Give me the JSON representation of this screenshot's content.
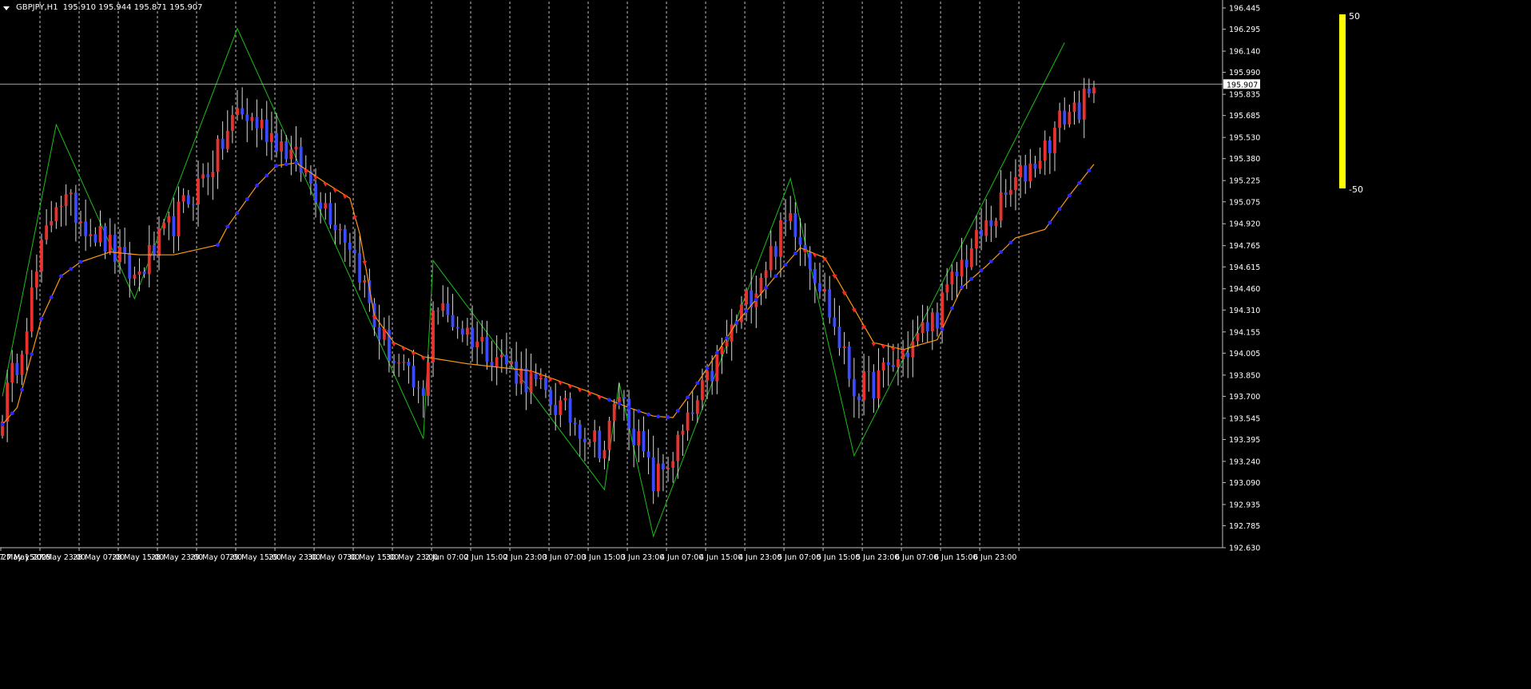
{
  "header": {
    "symbol": "GBPJPY,H1",
    "ohlc": "195.910 195.944 195.871 195.907"
  },
  "colors": {
    "background": "#000000",
    "bull_candle": "#e8322e",
    "bear_candle": "#3b4bff",
    "zigzag": "#18c018",
    "ma_line": "#ff9a10",
    "up_dots": "#2a2aff",
    "down_dots": "#ff2222",
    "histogram": "#ffff00",
    "grid": "#ffffff",
    "price_line": "#c8c8c8"
  },
  "histogram": {
    "top_label": "50",
    "bottom_label": "-50"
  },
  "chart_data": {
    "type": "candlestick",
    "symbol": "GBPJPY",
    "timeframe": "H1",
    "current_price": 195.907,
    "y_ticks": [
      "196.445",
      "196.295",
      "196.140",
      "195.990",
      "195.835",
      "195.685",
      "195.530",
      "195.380",
      "195.225",
      "195.075",
      "194.920",
      "194.765",
      "194.615",
      "194.460",
      "194.310",
      "194.155",
      "194.005",
      "193.850",
      "193.700",
      "193.545",
      "193.395",
      "193.240",
      "193.090",
      "192.935",
      "192.785",
      "192.630"
    ],
    "x_labels": [
      "27 May 2025",
      "27 May 15:00",
      "27 May 23:00",
      "28 May 07:00",
      "28 May 15:00",
      "28 May 23:00",
      "29 May 07:00",
      "29 May 15:00",
      "29 May 23:00",
      "30 May 07:00",
      "30 May 15:00",
      "30 May 23:00",
      "2 Jun 07:00",
      "2 Jun 15:00",
      "2 Jun 23:00",
      "3 Jun 07:00",
      "3 Jun 15:00",
      "3 Jun 23:00",
      "4 Jun 07:00",
      "4 Jun 15:00",
      "4 Jun 23:00",
      "5 Jun 07:00",
      "5 Jun 15:00",
      "5 Jun 23:00",
      "6 Jun 07:00",
      "6 Jun 15:00",
      "6 Jun 23:00"
    ],
    "zigzag": [
      {
        "t": 0,
        "p": 193.7
      },
      {
        "t": 11,
        "p": 195.62
      },
      {
        "t": 27,
        "p": 194.39
      },
      {
        "t": 48,
        "p": 196.3
      },
      {
        "t": 86,
        "p": 193.4
      },
      {
        "t": 88,
        "p": 194.66
      },
      {
        "t": 123,
        "p": 193.04
      },
      {
        "t": 126,
        "p": 193.8
      },
      {
        "t": 133,
        "p": 192.71
      },
      {
        "t": 161,
        "p": 195.24
      },
      {
        "t": 174,
        "p": 193.28
      },
      {
        "t": 217,
        "p": 196.2
      }
    ],
    "ma_anchors": [
      {
        "t": 0,
        "p": 193.5
      },
      {
        "t": 3,
        "p": 193.62
      },
      {
        "t": 8,
        "p": 194.25
      },
      {
        "t": 12,
        "p": 194.55
      },
      {
        "t": 16,
        "p": 194.65
      },
      {
        "t": 22,
        "p": 194.72
      },
      {
        "t": 28,
        "p": 194.7
      },
      {
        "t": 35,
        "p": 194.7
      },
      {
        "t": 44,
        "p": 194.77
      },
      {
        "t": 46,
        "p": 194.9
      },
      {
        "t": 52,
        "p": 195.19
      },
      {
        "t": 56,
        "p": 195.33
      },
      {
        "t": 60,
        "p": 195.35
      },
      {
        "t": 66,
        "p": 195.21
      },
      {
        "t": 71,
        "p": 195.1
      },
      {
        "t": 73,
        "p": 194.85
      },
      {
        "t": 76,
        "p": 194.27
      },
      {
        "t": 80,
        "p": 194.08
      },
      {
        "t": 86,
        "p": 193.98
      },
      {
        "t": 95,
        "p": 193.93
      },
      {
        "t": 108,
        "p": 193.88
      },
      {
        "t": 120,
        "p": 193.73
      },
      {
        "t": 128,
        "p": 193.62
      },
      {
        "t": 133,
        "p": 193.56
      },
      {
        "t": 137,
        "p": 193.55
      },
      {
        "t": 141,
        "p": 193.74
      },
      {
        "t": 150,
        "p": 194.22
      },
      {
        "t": 158,
        "p": 194.55
      },
      {
        "t": 163,
        "p": 194.75
      },
      {
        "t": 168,
        "p": 194.68
      },
      {
        "t": 173,
        "p": 194.38
      },
      {
        "t": 178,
        "p": 194.08
      },
      {
        "t": 184,
        "p": 194.03
      },
      {
        "t": 191,
        "p": 194.1
      },
      {
        "t": 196,
        "p": 194.47
      },
      {
        "t": 201,
        "p": 194.62
      },
      {
        "t": 207,
        "p": 194.82
      },
      {
        "t": 213,
        "p": 194.88
      },
      {
        "t": 218,
        "p": 195.12
      },
      {
        "t": 223,
        "p": 195.34
      }
    ],
    "down_ranges": [
      [
        61,
        76
      ],
      [
        77,
        89
      ],
      [
        108,
        123
      ],
      [
        163,
        184
      ]
    ],
    "dot_step": 2,
    "candle_count": 224,
    "hist_range": [
      -50,
      50
    ]
  }
}
